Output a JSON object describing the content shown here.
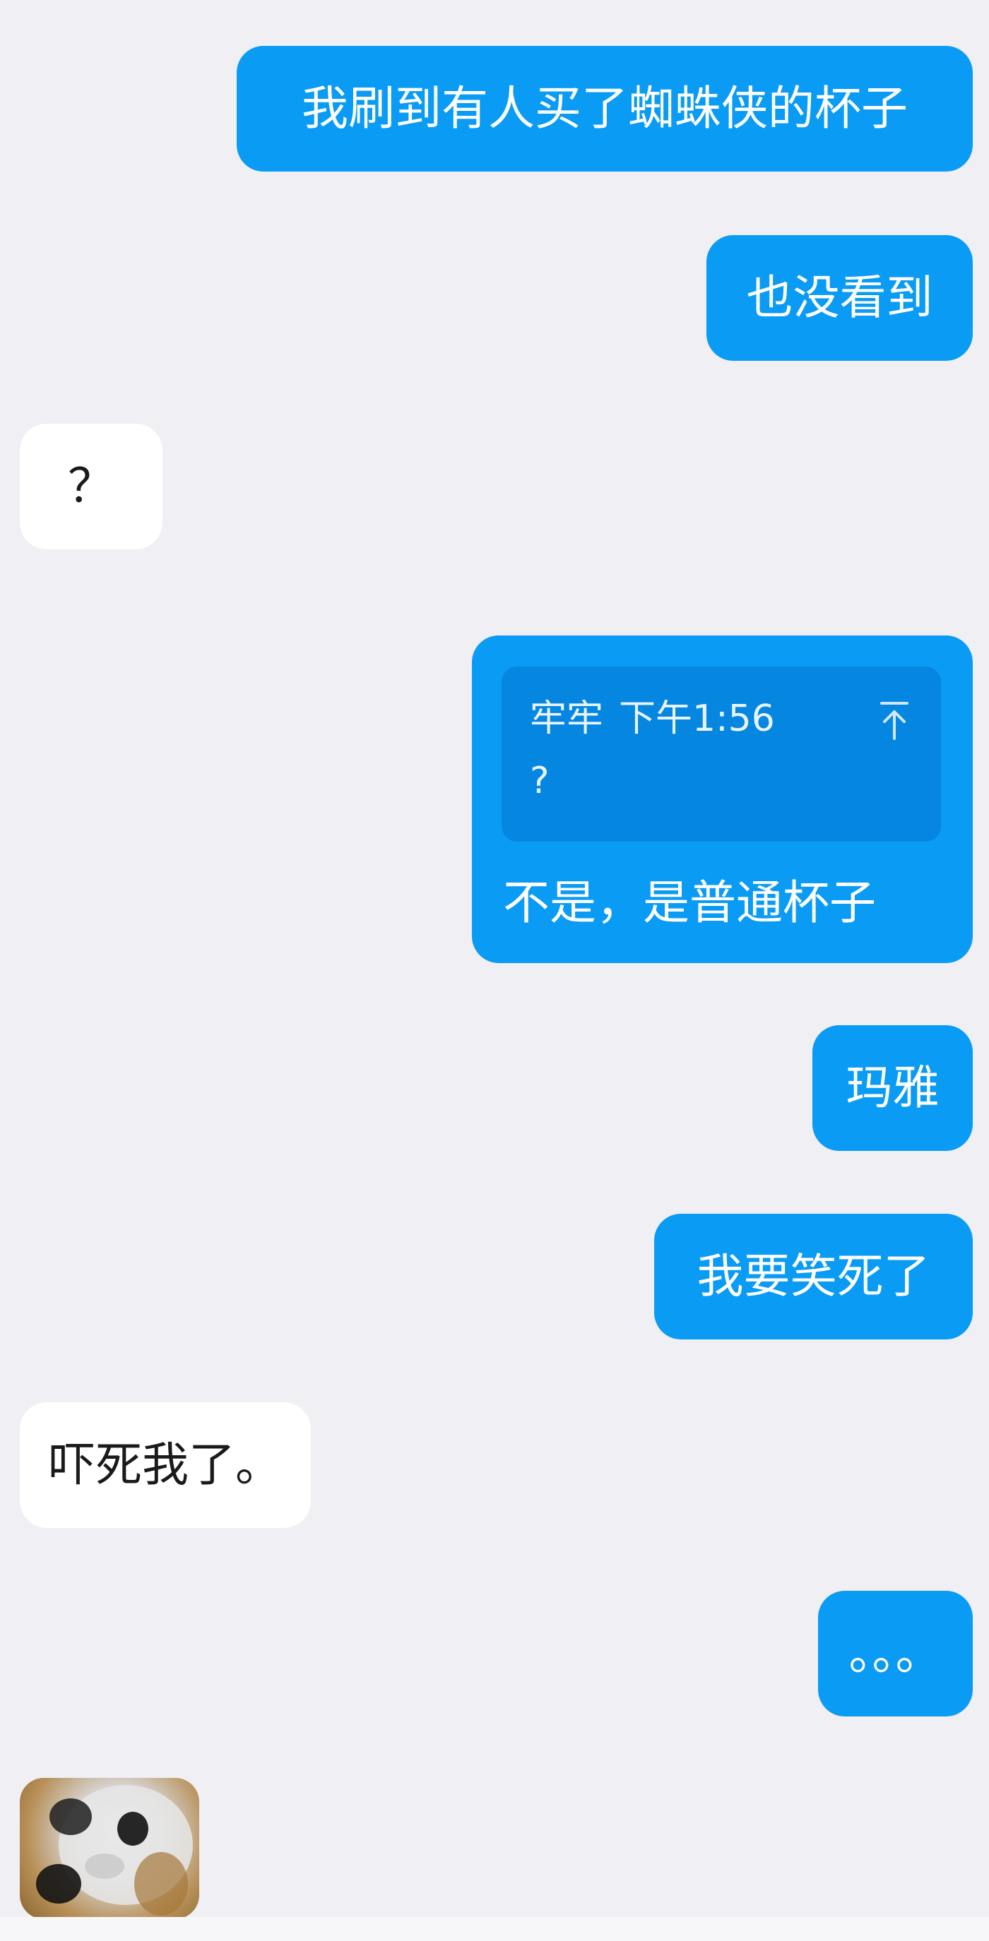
{
  "messages": [
    {
      "side": "outgoing",
      "text": "我刷到有人买了蜘蛛侠的杯子"
    },
    {
      "side": "outgoing",
      "text": "也没看到"
    },
    {
      "side": "incoming",
      "text": "？"
    },
    {
      "side": "outgoing",
      "quote": {
        "sender": "牢牢",
        "time": "下午1:56",
        "text": "?"
      },
      "text": "不是，是普通杯子"
    },
    {
      "side": "outgoing",
      "text": "玛雅"
    },
    {
      "side": "outgoing",
      "text": "我要笑死了"
    },
    {
      "side": "incoming",
      "text": "吓死我了。"
    },
    {
      "side": "outgoing",
      "text": "。。。"
    },
    {
      "side": "incoming",
      "sticker": "dog-face-sticker"
    }
  ],
  "colors": {
    "background": "#efeff4",
    "outgoing_bubble": "#0a9bf5",
    "quote_box": "#0586e0",
    "incoming_bubble": "#ffffff"
  },
  "icons": {
    "quote_jump": "arrow-up-to-top-icon"
  }
}
